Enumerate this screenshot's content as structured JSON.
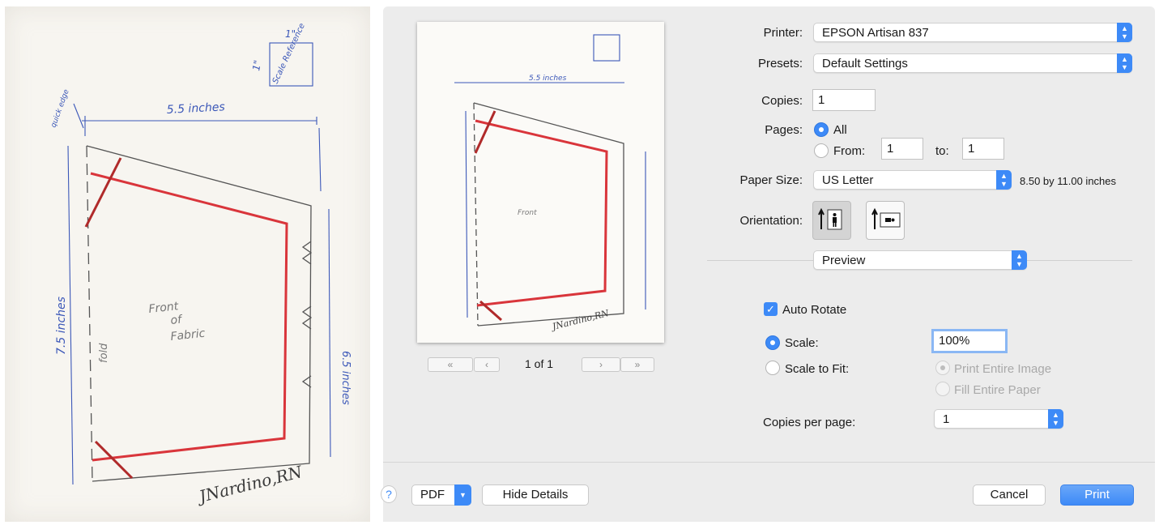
{
  "scan": {
    "top_measure": "5.5 inches",
    "left_measure": "7.5 inches",
    "right_measure": "6.5 inches",
    "fold_label": "fold",
    "center_line1": "Front",
    "center_line2": "of",
    "center_line3": "Fabric",
    "scale_box_top": "1\"",
    "scale_box_left": "1\"",
    "scale_box_text": "Scale Reference",
    "corner_note": "quick edge",
    "signature": "JNardino,RN"
  },
  "preview": {
    "page_indicator": "1 of 1",
    "nav_first": "«",
    "nav_prev": "‹",
    "nav_next": "›",
    "nav_last": "»"
  },
  "form": {
    "printer_label": "Printer:",
    "printer_value": "EPSON Artisan 837",
    "presets_label": "Presets:",
    "presets_value": "Default Settings",
    "copies_label": "Copies:",
    "copies_value": "1",
    "pages_label": "Pages:",
    "pages_all": "All",
    "pages_from": "From:",
    "pages_from_value": "1",
    "pages_to": "to:",
    "pages_to_value": "1",
    "paper_size_label": "Paper Size:",
    "paper_size_value": "US Letter",
    "paper_size_dims": "8.50 by 11.00 inches",
    "orientation_label": "Orientation:",
    "app_section": "Preview",
    "auto_rotate": "Auto Rotate",
    "scale_label": "Scale:",
    "scale_value": "100%",
    "scale_to_fit": "Scale to Fit:",
    "print_entire_image": "Print Entire Image",
    "fill_entire_paper": "Fill Entire Paper",
    "copies_per_page_label": "Copies per page:",
    "copies_per_page_value": "1"
  },
  "footer": {
    "help": "?",
    "pdf": "PDF",
    "hide_details": "Hide Details",
    "cancel": "Cancel",
    "print": "Print"
  },
  "colors": {
    "accent": "#3d8af7",
    "red_line": "#d9353b",
    "blue_ink": "#3b57b8"
  }
}
